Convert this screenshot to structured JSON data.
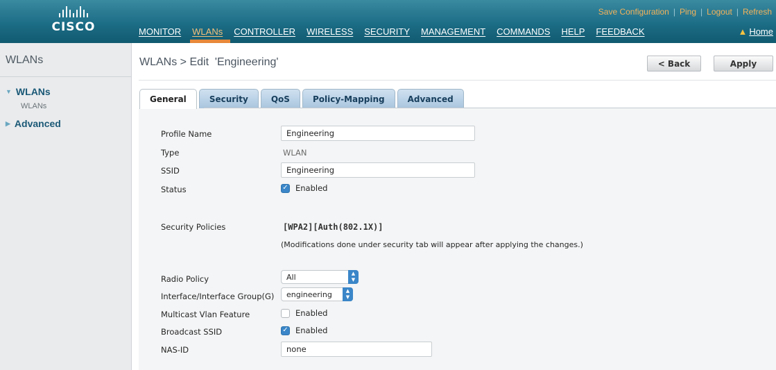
{
  "header": {
    "logo_text": "CISCO",
    "nav": [
      "MONITOR",
      "WLANs",
      "CONTROLLER",
      "WIRELESS",
      "SECURITY",
      "MANAGEMENT",
      "COMMANDS",
      "HELP",
      "FEEDBACK"
    ],
    "active_nav": "WLANs",
    "links": [
      "Save Configuration",
      "Ping",
      "Logout",
      "Refresh"
    ],
    "home": "Home",
    "colors": {
      "bar": "#1c6d86",
      "link": "#f2b25a",
      "active_marker": "#e8883a"
    }
  },
  "sidebar": {
    "title": "WLANs",
    "items": [
      {
        "label": "WLANs",
        "expanded": true,
        "subitems": [
          "WLANs"
        ]
      },
      {
        "label": "Advanced",
        "expanded": false
      }
    ]
  },
  "main": {
    "title": "WLANs > Edit  'Engineering'",
    "buttons": {
      "back": "< Back",
      "apply": "Apply"
    },
    "tabs": [
      "General",
      "Security",
      "QoS",
      "Policy-Mapping",
      "Advanced"
    ],
    "active_tab": "General"
  },
  "form": {
    "profile_name": {
      "label": "Profile Name",
      "value": "Engineering"
    },
    "type": {
      "label": "Type",
      "value": "WLAN"
    },
    "ssid": {
      "label": "SSID",
      "value": "Engineering"
    },
    "status": {
      "label": "Status",
      "checked": true,
      "text": "Enabled"
    },
    "security_policies": {
      "label": "Security Policies",
      "value": "[WPA2][Auth(802.1X)]",
      "note": "(Modifications done under security tab will appear after applying the changes.)"
    },
    "radio_policy": {
      "label": "Radio Policy",
      "value": "All"
    },
    "interface_group": {
      "label": "Interface/Interface Group(G)",
      "value": "engineering"
    },
    "multicast_vlan": {
      "label": "Multicast Vlan Feature",
      "checked": false,
      "text": "Enabled"
    },
    "broadcast_ssid": {
      "label": "Broadcast SSID",
      "checked": true,
      "text": "Enabled"
    },
    "nas_id": {
      "label": "NAS-ID",
      "value": "none"
    }
  }
}
